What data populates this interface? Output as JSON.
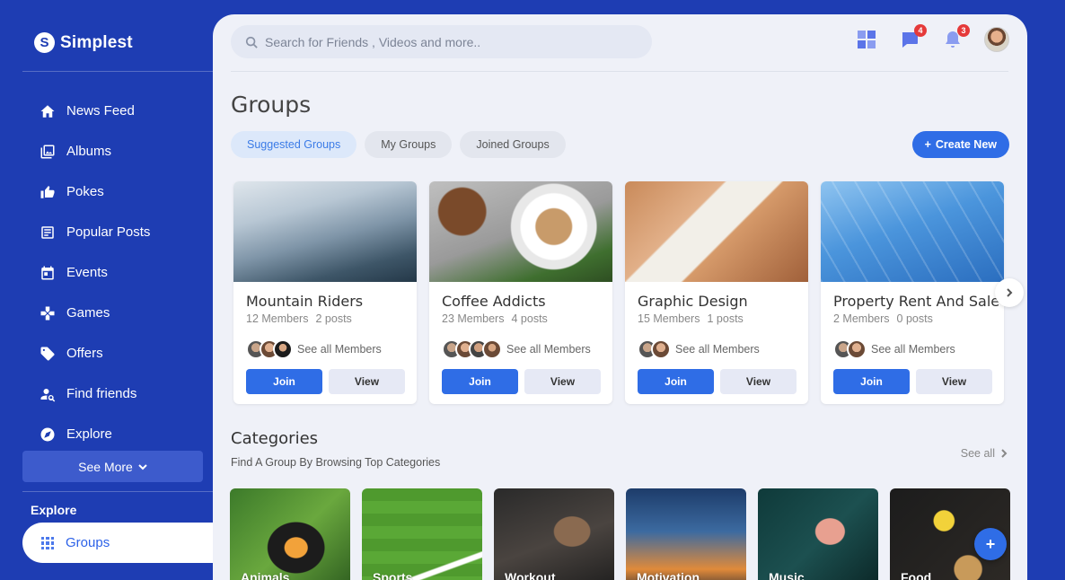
{
  "brand": {
    "logo": "S",
    "name": "Simplest"
  },
  "sidebar": {
    "items": [
      {
        "label": "News Feed",
        "icon": "home-icon"
      },
      {
        "label": "Albums",
        "icon": "albums-icon"
      },
      {
        "label": "Pokes",
        "icon": "poke-icon"
      },
      {
        "label": "Popular Posts",
        "icon": "posts-icon"
      },
      {
        "label": "Events",
        "icon": "calendar-icon"
      },
      {
        "label": "Games",
        "icon": "gamepad-icon"
      },
      {
        "label": "Offers",
        "icon": "tag-icon"
      },
      {
        "label": "Find friends",
        "icon": "find-friends-icon"
      },
      {
        "label": "Explore",
        "icon": "compass-icon"
      }
    ],
    "see_more": "See More",
    "section_title": "Explore",
    "active_item": "Groups"
  },
  "header": {
    "search_placeholder": "Search for Friends , Videos and more..",
    "messages_count": "4",
    "notifications_count": "3"
  },
  "page": {
    "title": "Groups",
    "tabs": [
      "Suggested Groups",
      "My Groups",
      "Joined Groups"
    ],
    "active_tab": "Suggested Groups",
    "create_label": "Create New"
  },
  "groups": [
    {
      "name": "Mountain Riders",
      "members": "12 Members",
      "posts": "2 posts",
      "see_all": "See all Members",
      "join": "Join",
      "view": "View"
    },
    {
      "name": "Coffee Addicts",
      "members": "23 Members",
      "posts": "4 posts",
      "see_all": "See all Members",
      "join": "Join",
      "view": "View"
    },
    {
      "name": "Graphic Design",
      "members": "15 Members",
      "posts": "1 posts",
      "see_all": "See all Members",
      "join": "Join",
      "view": "View"
    },
    {
      "name": "Property Rent And Sale",
      "members": "2 Members",
      "posts": "0 posts",
      "see_all": "See all Members",
      "join": "Join",
      "view": "View"
    }
  ],
  "categories": {
    "title": "Categories",
    "subtitle": "Find A Group By Browsing Top Categories",
    "see_all": "See all",
    "items": [
      "Animals",
      "Sports",
      "Workout",
      "Motivation",
      "Music",
      "Food"
    ]
  },
  "colors": {
    "primary": "#2f6de6",
    "sidebar": "#1e3db3",
    "background": "#eff1f8"
  }
}
